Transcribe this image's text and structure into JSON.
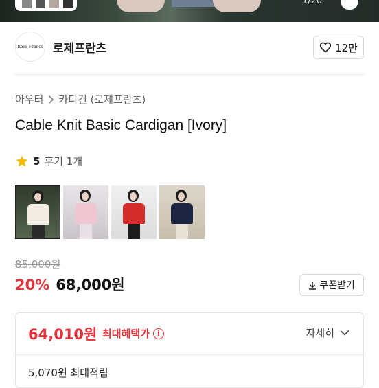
{
  "hero": {
    "counter": "1/20"
  },
  "store": {
    "logo_text": "Rosé Francs",
    "name": "로제프란츠",
    "likes": "12만"
  },
  "breadcrumb": {
    "category": "아우터",
    "subcategory": "카디건 (로제프란츠)"
  },
  "product": {
    "title": "Cable Knit Basic Cardigan [Ivory]"
  },
  "rating": {
    "score": "5",
    "review_label": "후기 1개"
  },
  "gallery": {
    "items": [
      "black-skirt-ivory-cardigan",
      "pink-cardigan",
      "red-cardigan",
      "navy-cardigan"
    ]
  },
  "pricing": {
    "original_price": "85,000원",
    "discount": "20%",
    "price": "68,000원",
    "coupon_label": "쿠폰받기"
  },
  "benefit": {
    "max_price": "64,010원",
    "max_label": "최대혜택가",
    "detail_label": "자세히",
    "points": "5,070원 최대적립"
  },
  "colors": {
    "accent": "#e5343b",
    "star": "#f5b800"
  }
}
